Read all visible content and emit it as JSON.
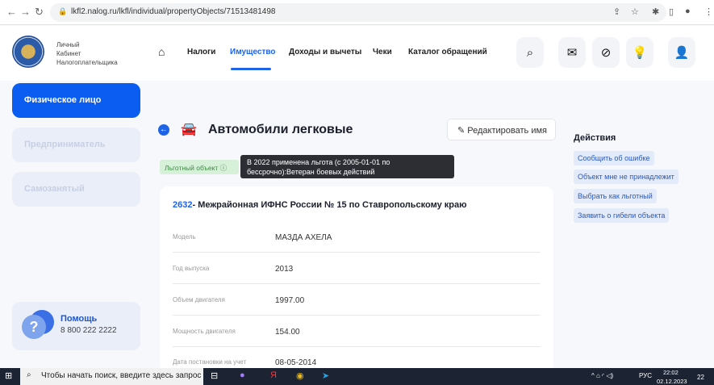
{
  "browser": {
    "url": "lkfl2.nalog.ru/lkfl/individual/propertyObjects/71513481498"
  },
  "header": {
    "brand": [
      "Личный",
      "Кабинет",
      "Налогоплательщика"
    ],
    "nav": [
      "Налоги",
      "Имущество",
      "Доходы и вычеты",
      "Чеки",
      "Каталог обращений"
    ]
  },
  "sidebar": {
    "items": [
      "Физическое лицо",
      "Предприниматель",
      "Самозанятый"
    ],
    "help_title": "Помощь",
    "help_phone": "8 800 222 2222"
  },
  "main": {
    "title": "Автомобили легковые",
    "edit_label": "Редактировать имя",
    "badge": "Льготный объект",
    "tooltip": "В 2022 применена льгота (с 2005-01-01 по бессрочно):Ветеран боевых действий",
    "card_code": "2632",
    "card_title": "- Межрайонная ИФНС России № 15 по Ставропольскому краю",
    "rows": [
      {
        "label": "Модель",
        "value": "МАЗДА АХЕЛА"
      },
      {
        "label": "Год выпуска",
        "value": "2013"
      },
      {
        "label": "Объем двигателя",
        "value": "1997.00"
      },
      {
        "label": "Мощность двигателя",
        "value": "154.00"
      },
      {
        "label": "Дата постановки на учет",
        "value": "08-05-2014"
      }
    ]
  },
  "actions": {
    "title": "Действия",
    "items": [
      "Сообщить об ошибке",
      "Объект мне не принадлежит",
      "Выбрать как льготный",
      "Заявить о гибели объекта"
    ]
  },
  "taskbar": {
    "search": "Чтобы начать поиск, введите здесь запрос",
    "lang": "РУС",
    "time": "22:02",
    "date": "02.12.2023",
    "notifications": "22"
  }
}
